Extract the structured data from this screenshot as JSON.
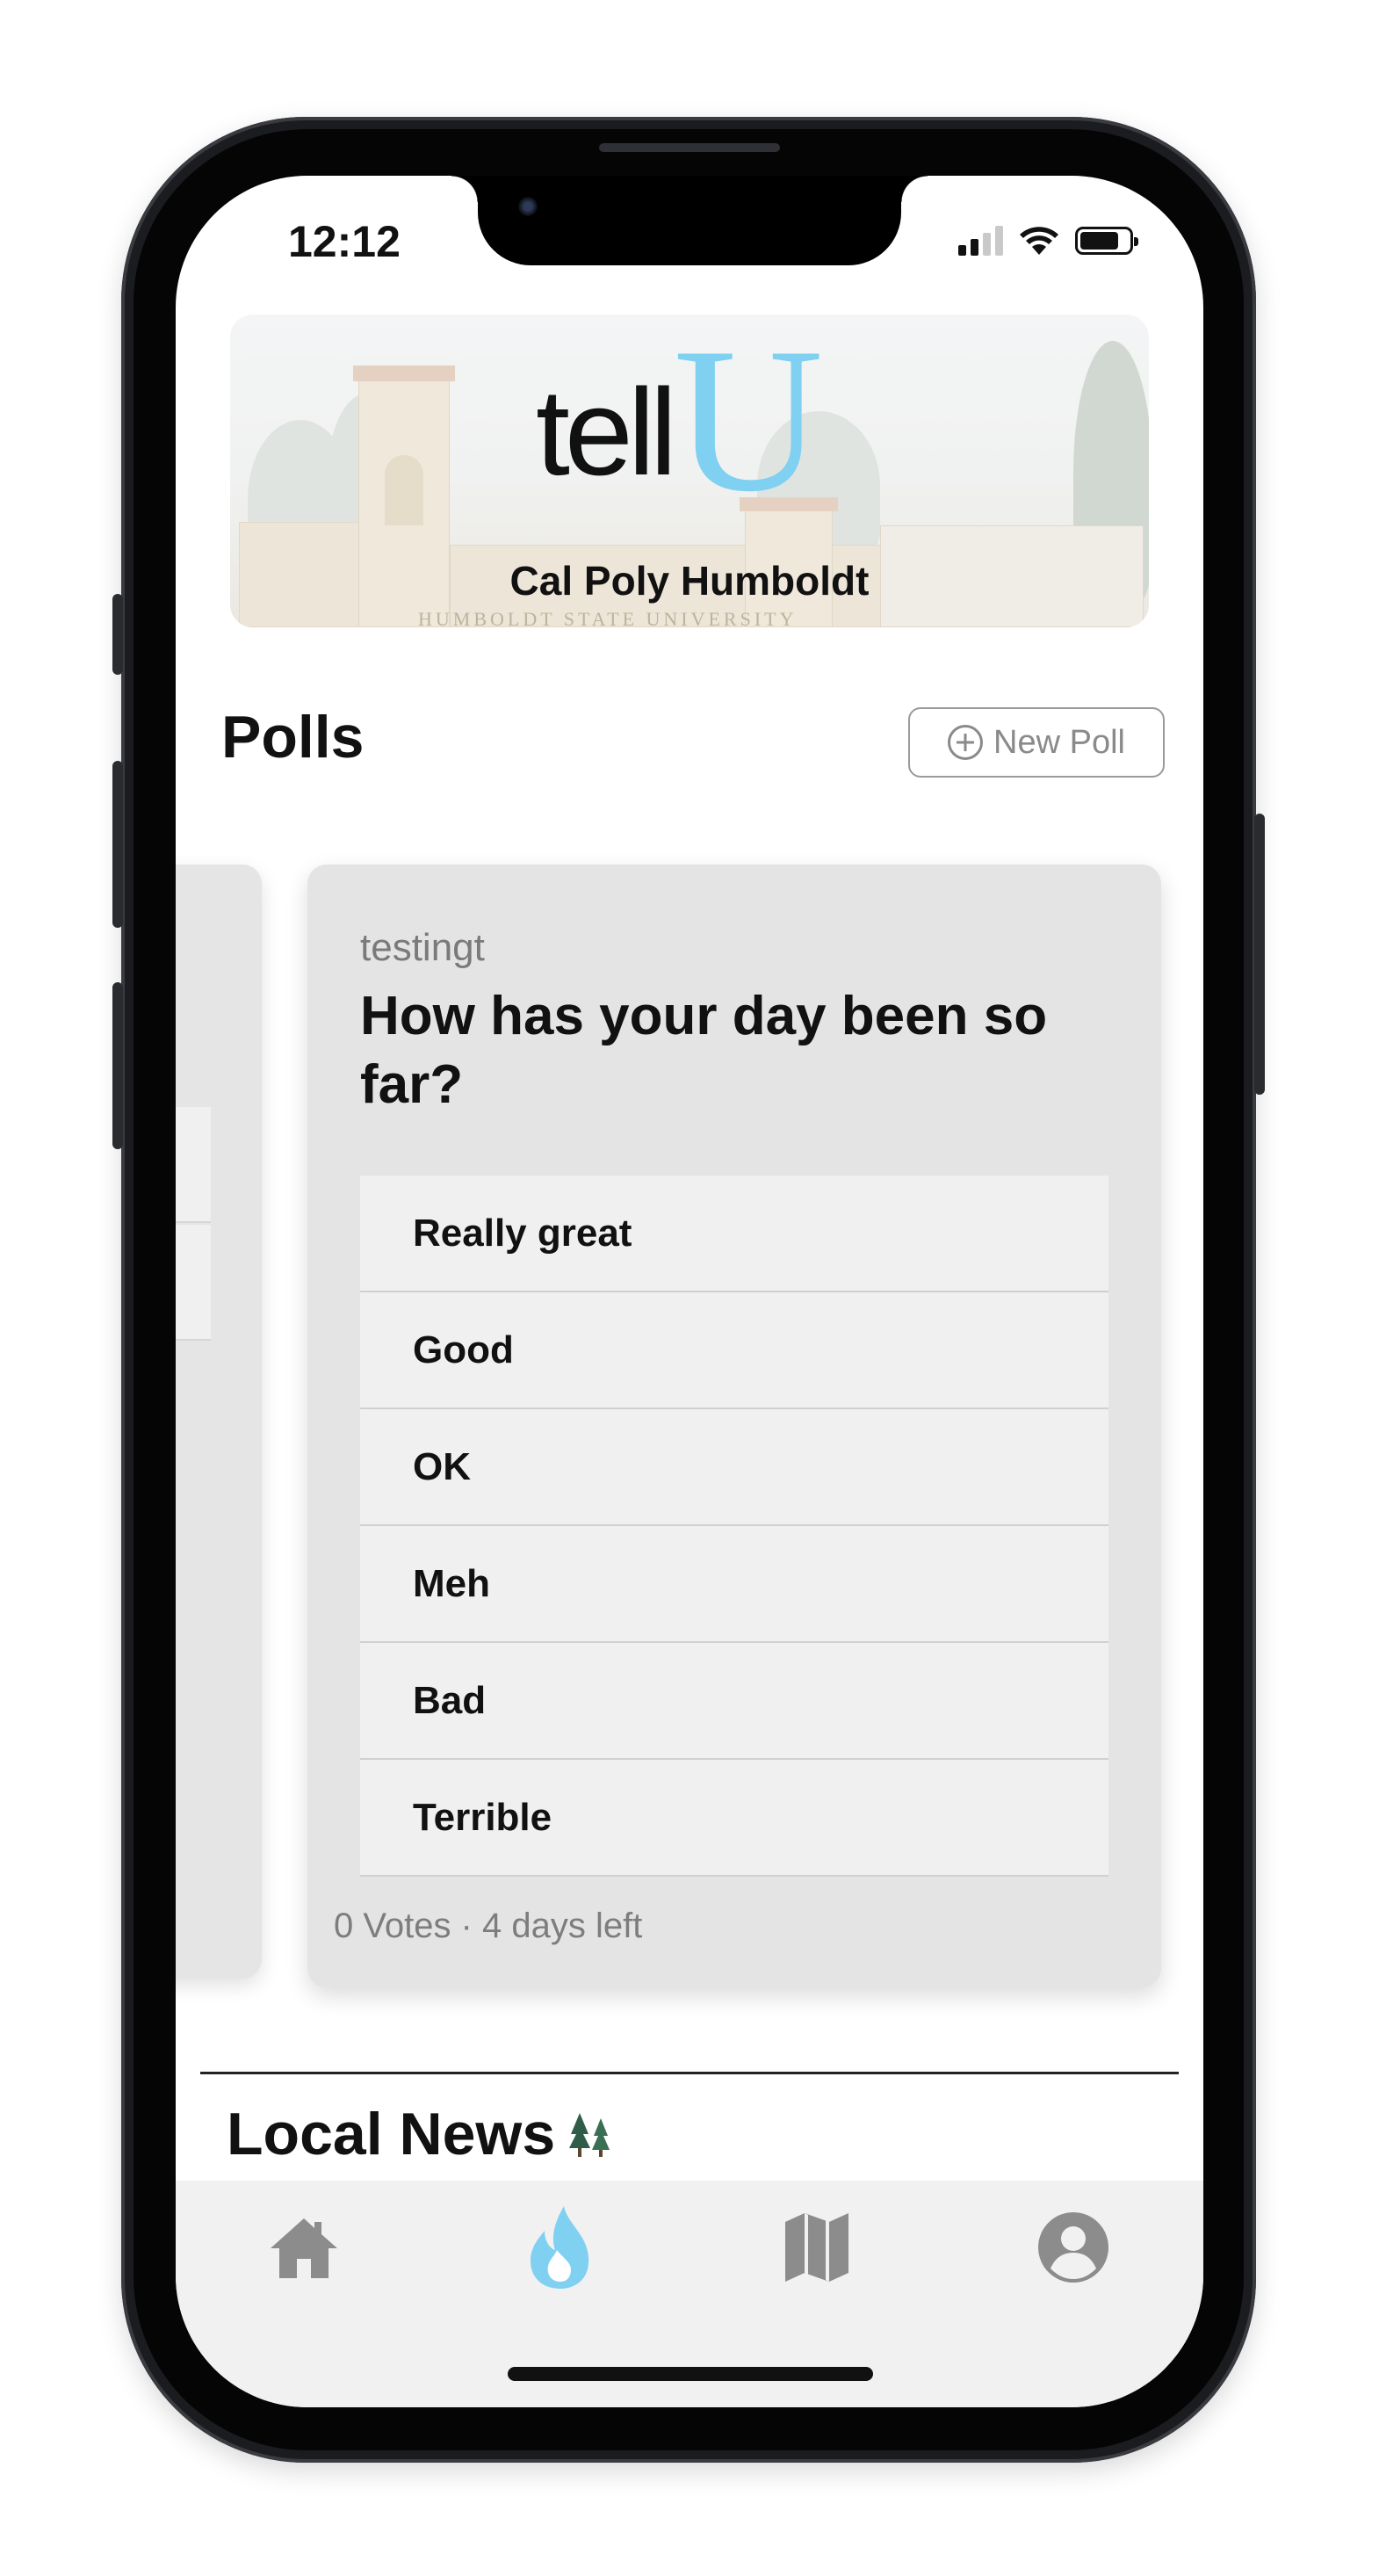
{
  "status_bar": {
    "time": "12:12"
  },
  "header": {
    "logo_text_main": "tell",
    "logo_text_accent": "U",
    "school_name": "Cal Poly Humboldt",
    "banner_engraving": "HUMBOLDT STATE UNIVERSITY"
  },
  "polls": {
    "title": "Polls",
    "new_poll_label": "New Poll",
    "card": {
      "author": "testingt",
      "question": "How has your day been so far?",
      "options": [
        "Really great",
        "Good",
        "OK",
        "Meh",
        "Bad",
        "Terrible"
      ],
      "footer": "0 Votes · 4 days left"
    }
  },
  "news": {
    "title": "Local News"
  },
  "tabbar": {
    "items": [
      {
        "icon": "home-icon",
        "active": false
      },
      {
        "icon": "flame-icon",
        "active": true
      },
      {
        "icon": "map-icon",
        "active": false
      },
      {
        "icon": "profile-icon",
        "active": false
      }
    ]
  },
  "colors": {
    "accent": "#7fd0f1",
    "inactive_icon": "#8c8c8c",
    "card_bg": "#e4e4e4",
    "option_bg": "#f0f0f0"
  }
}
